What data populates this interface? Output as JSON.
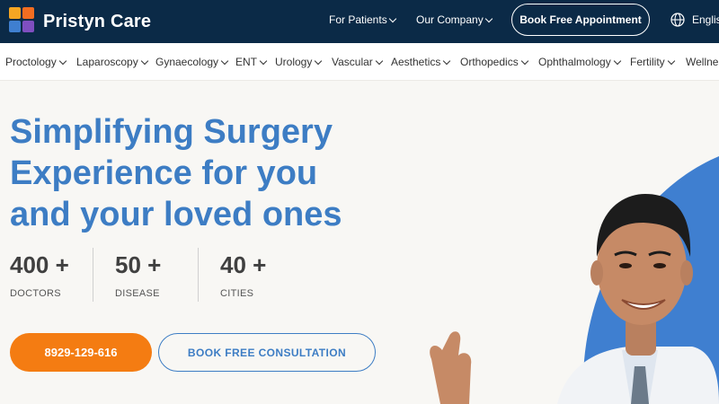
{
  "header": {
    "brand": "Pristyn Care",
    "nav": [
      {
        "label": "For Patients"
      },
      {
        "label": "Our Company"
      }
    ],
    "cta_label": "Book Free Appointment",
    "language": "English"
  },
  "categories": [
    {
      "label": "Proctology"
    },
    {
      "label": "Laparoscopy"
    },
    {
      "label": "Gynaecology"
    },
    {
      "label": "ENT"
    },
    {
      "label": "Urology"
    },
    {
      "label": "Vascular"
    },
    {
      "label": "Aesthetics"
    },
    {
      "label": "Orthopedics"
    },
    {
      "label": "Ophthalmology"
    },
    {
      "label": "Fertility"
    },
    {
      "label": "Wellness"
    }
  ],
  "hero": {
    "title_line1": "Simplifying Surgery",
    "title_line2": "Experience for you",
    "title_line3": "and your loved ones",
    "stats": [
      {
        "value": "400 +",
        "label": "DOCTORS"
      },
      {
        "value": "50 +",
        "label": "DISEASE"
      },
      {
        "value": "40 +",
        "label": "CITIES"
      }
    ],
    "phone_label": "8929-129-616",
    "consult_label": "BOOK FREE CONSULTATION"
  },
  "colors": {
    "navbar": "#0b2a47",
    "accent_blue": "#3d7dc4",
    "accent_orange": "#f47c12"
  }
}
